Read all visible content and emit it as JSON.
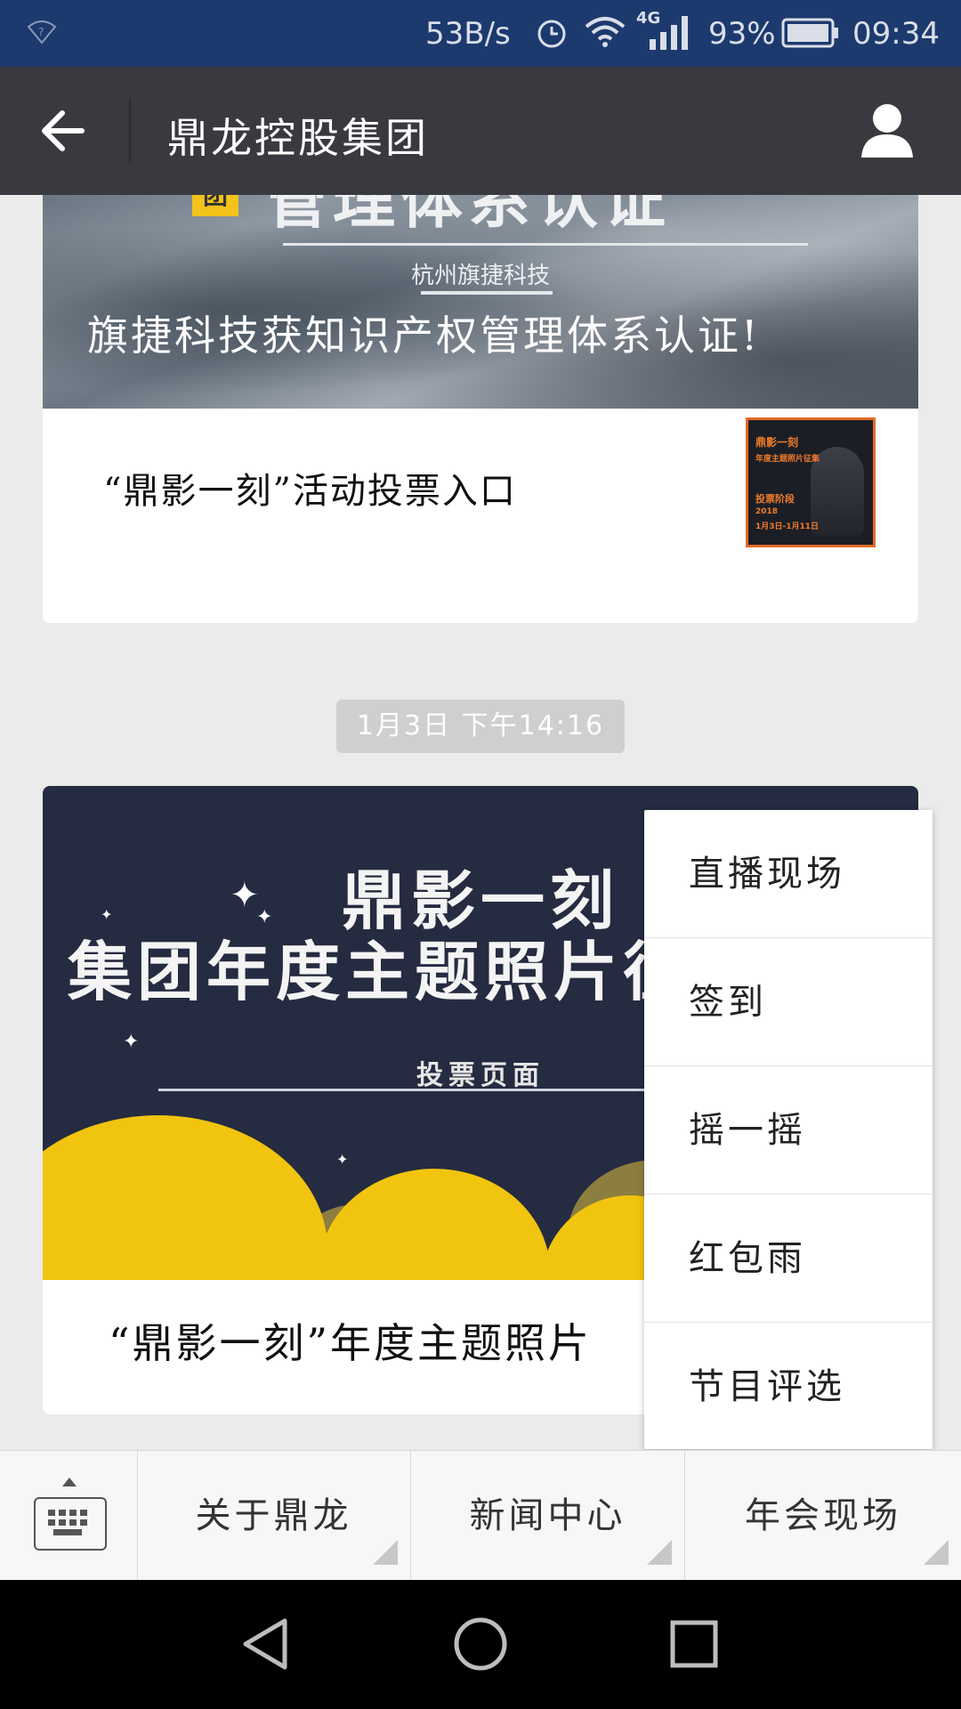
{
  "status_bar": {
    "net_speed": "53B/s",
    "network": "4G",
    "battery": "93%",
    "time": "09:34"
  },
  "header": {
    "title": "鼎龙控股集团"
  },
  "messages": {
    "card1": {
      "banner_heading_partial": "管理体系认证",
      "banner_logo": "团",
      "banner_sub": "杭州旗捷科技",
      "banner_headline": "旗捷科技获知识产权管理体系认证!",
      "article_title": "“鼎影一刻”活动投票入口",
      "thumb_lines": [
        "鼎影一刻",
        "年度主题照片征集",
        "投票阶段",
        "2018",
        "1月3日-1月11日"
      ]
    },
    "timestamp": "1月3日 下午14:16",
    "card2": {
      "banner_title1": "鼎影一刻",
      "banner_title2": "集团年度主题照片征",
      "banner_vote_label": "投票页面",
      "article_title": "“鼎影一刻”年度主题照片"
    }
  },
  "popup_menu": {
    "items": [
      "直播现场",
      "签到",
      "摇一摇",
      "红包雨",
      "节目评选"
    ]
  },
  "bottom_menu": {
    "tabs": [
      "关于鼎龙",
      "新闻中心",
      "年会现场"
    ]
  },
  "colors": {
    "status_bar_bg": "#1d3a6e",
    "title_bar_bg": "#393a3f",
    "chat_bg": "#ebebeb",
    "banner2_bg": "#252b40",
    "cloud_yellow": "#f1c40f"
  }
}
